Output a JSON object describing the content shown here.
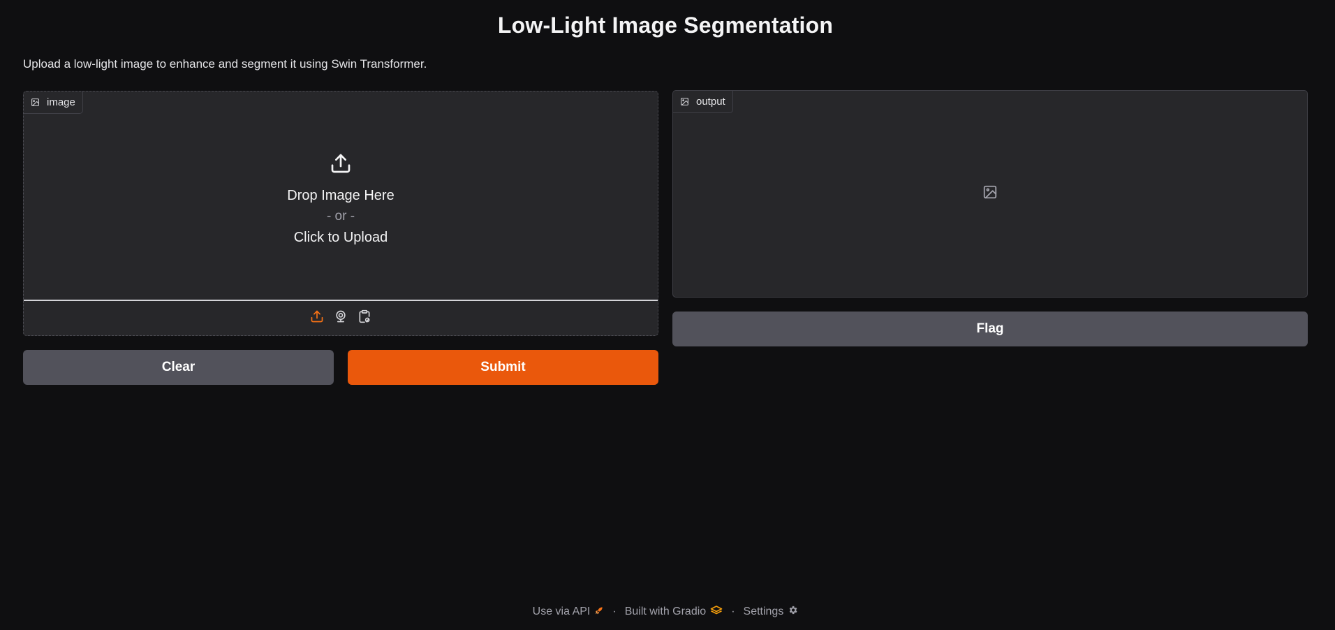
{
  "app": {
    "title": "Low-Light Image Segmentation",
    "description": "Upload a low-light image to enhance and segment it using Swin Transformer."
  },
  "input_panel": {
    "label": "image",
    "drop_text": "Drop Image Here",
    "or_text": "- or -",
    "click_text": "Click to Upload",
    "sources": [
      {
        "icon": "upload-icon",
        "active": true
      },
      {
        "icon": "webcam-icon",
        "active": false
      },
      {
        "icon": "clipboard-icon",
        "active": false
      }
    ]
  },
  "output_panel": {
    "label": "output",
    "placeholder_icon": "image-icon"
  },
  "buttons": {
    "clear": "Clear",
    "submit": "Submit",
    "flag": "Flag"
  },
  "footer": {
    "api": "Use via API",
    "built_with": "Built with Gradio",
    "settings": "Settings",
    "separator": "·"
  },
  "colors": {
    "background": "#0f0f11",
    "panel": "#27272a",
    "primary": "#ea580c",
    "secondary": "#52525b",
    "accent_icon": "#f97316",
    "gradio_logo": "#f59e0b"
  }
}
